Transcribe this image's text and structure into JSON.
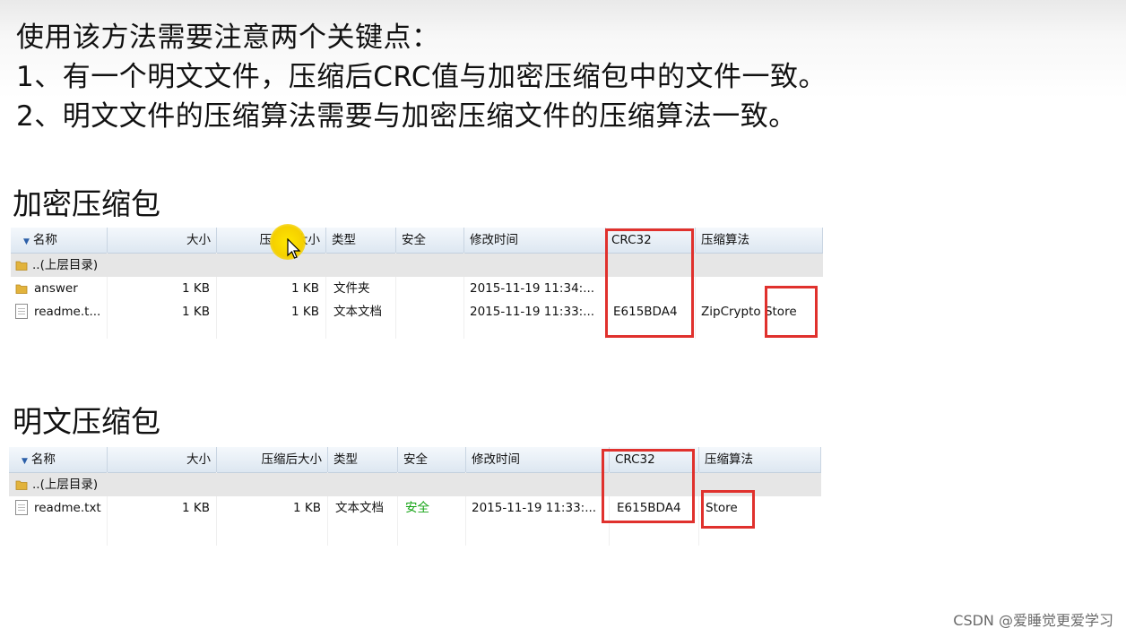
{
  "notes": [
    "使用该方法需要注意两个关键点：",
    "1、有一个明文文件，压缩后CRC值与加密压缩包中的文件一致。",
    "2、明文文件的压缩算法需要与加密压缩文件的压缩算法一致。"
  ],
  "encrypted": {
    "title": "加密压缩包",
    "headers": [
      "名称",
      "大小",
      "压缩后大小",
      "类型",
      "安全",
      "修改时间",
      "CRC32",
      "压缩算法"
    ],
    "parent_row": "..(上层目录)",
    "rows": [
      {
        "name": "answer",
        "size": "1 KB",
        "packed": "1 KB",
        "type": "文件夹",
        "security": "",
        "modified": "2015-11-19 11:34:...",
        "crc": "",
        "method": "",
        "icon": "folder-icon"
      },
      {
        "name": "readme.t...",
        "size": "1 KB",
        "packed": "1 KB",
        "type": "文本文档",
        "security": "",
        "modified": "2015-11-19 11:33:...",
        "crc": "E615BDA4",
        "method": "ZipCrypto Store",
        "icon": "document-icon"
      }
    ]
  },
  "plain": {
    "title": "明文压缩包",
    "headers": [
      "名称",
      "大小",
      "压缩后大小",
      "类型",
      "安全",
      "修改时间",
      "CRC32",
      "压缩算法"
    ],
    "parent_row": "..(上层目录)",
    "rows": [
      {
        "name": "readme.txt",
        "size": "1 KB",
        "packed": "1 KB",
        "type": "文本文档",
        "security": "安全",
        "modified": "2015-11-19 11:33:...",
        "crc": "E615BDA4",
        "method": "Store",
        "icon": "document-icon"
      }
    ]
  },
  "colors": {
    "highlight_box": "#e0312d",
    "security_ok": "#13a313",
    "cursor_highlight": "#f5d000"
  },
  "watermark": "CSDN @爱睡觉更爱学习"
}
